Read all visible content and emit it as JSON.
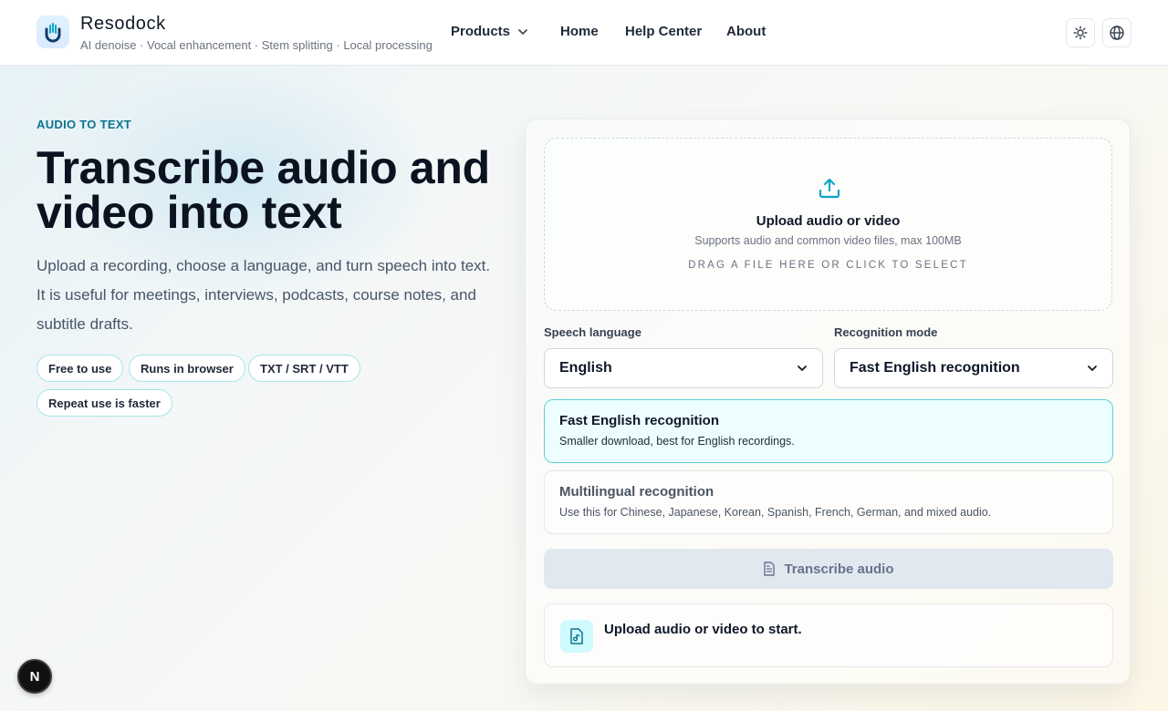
{
  "brand": {
    "name": "Resodock",
    "tagline": "AI denoise · Vocal enhancement · Stem splitting · Local processing"
  },
  "nav": {
    "products": "Products",
    "home": "Home",
    "help": "Help Center",
    "about": "About"
  },
  "header_actions": {
    "theme_icon": "sun-icon",
    "language_icon": "globe-icon"
  },
  "hero": {
    "eyebrow": "AUDIO TO TEXT",
    "title": "Transcribe audio and video into text",
    "description": "Upload a recording, choose a language, and turn speech into text. It is useful for meetings, interviews, podcasts, course notes, and subtitle drafts.",
    "chips": [
      "Free to use",
      "Runs in browser",
      "TXT / SRT / VTT",
      "Repeat use is faster"
    ]
  },
  "upload": {
    "title": "Upload audio or video",
    "subtitle": "Supports audio and common video files, max 100MB",
    "hint": "DRAG A FILE HERE OR CLICK TO SELECT",
    "icon": "upload-icon"
  },
  "settings": {
    "language_label": "Speech language",
    "language_value": "English",
    "mode_label": "Recognition mode",
    "mode_value": "Fast English recognition"
  },
  "modes": [
    {
      "title": "Fast English recognition",
      "description": "Smaller download, best for English recordings.",
      "selected": true
    },
    {
      "title": "Multilingual recognition",
      "description": "Use this for Chinese, Japanese, Korean, Spanish, French, German, and mixed audio.",
      "selected": false
    }
  ],
  "action": {
    "transcribe_label": "Transcribe audio",
    "icon": "document-icon"
  },
  "status": {
    "message": "Upload audio or video to start.",
    "icon": "file-audio-icon"
  },
  "fab": {
    "label": "N"
  },
  "colors": {
    "accent": "#0e7490",
    "upload_icon": "#0ea5c6",
    "selected_card_bg": "#ecfeff",
    "selected_card_border": "#5ecfd8",
    "disabled_button_bg": "#e2e8f0"
  }
}
